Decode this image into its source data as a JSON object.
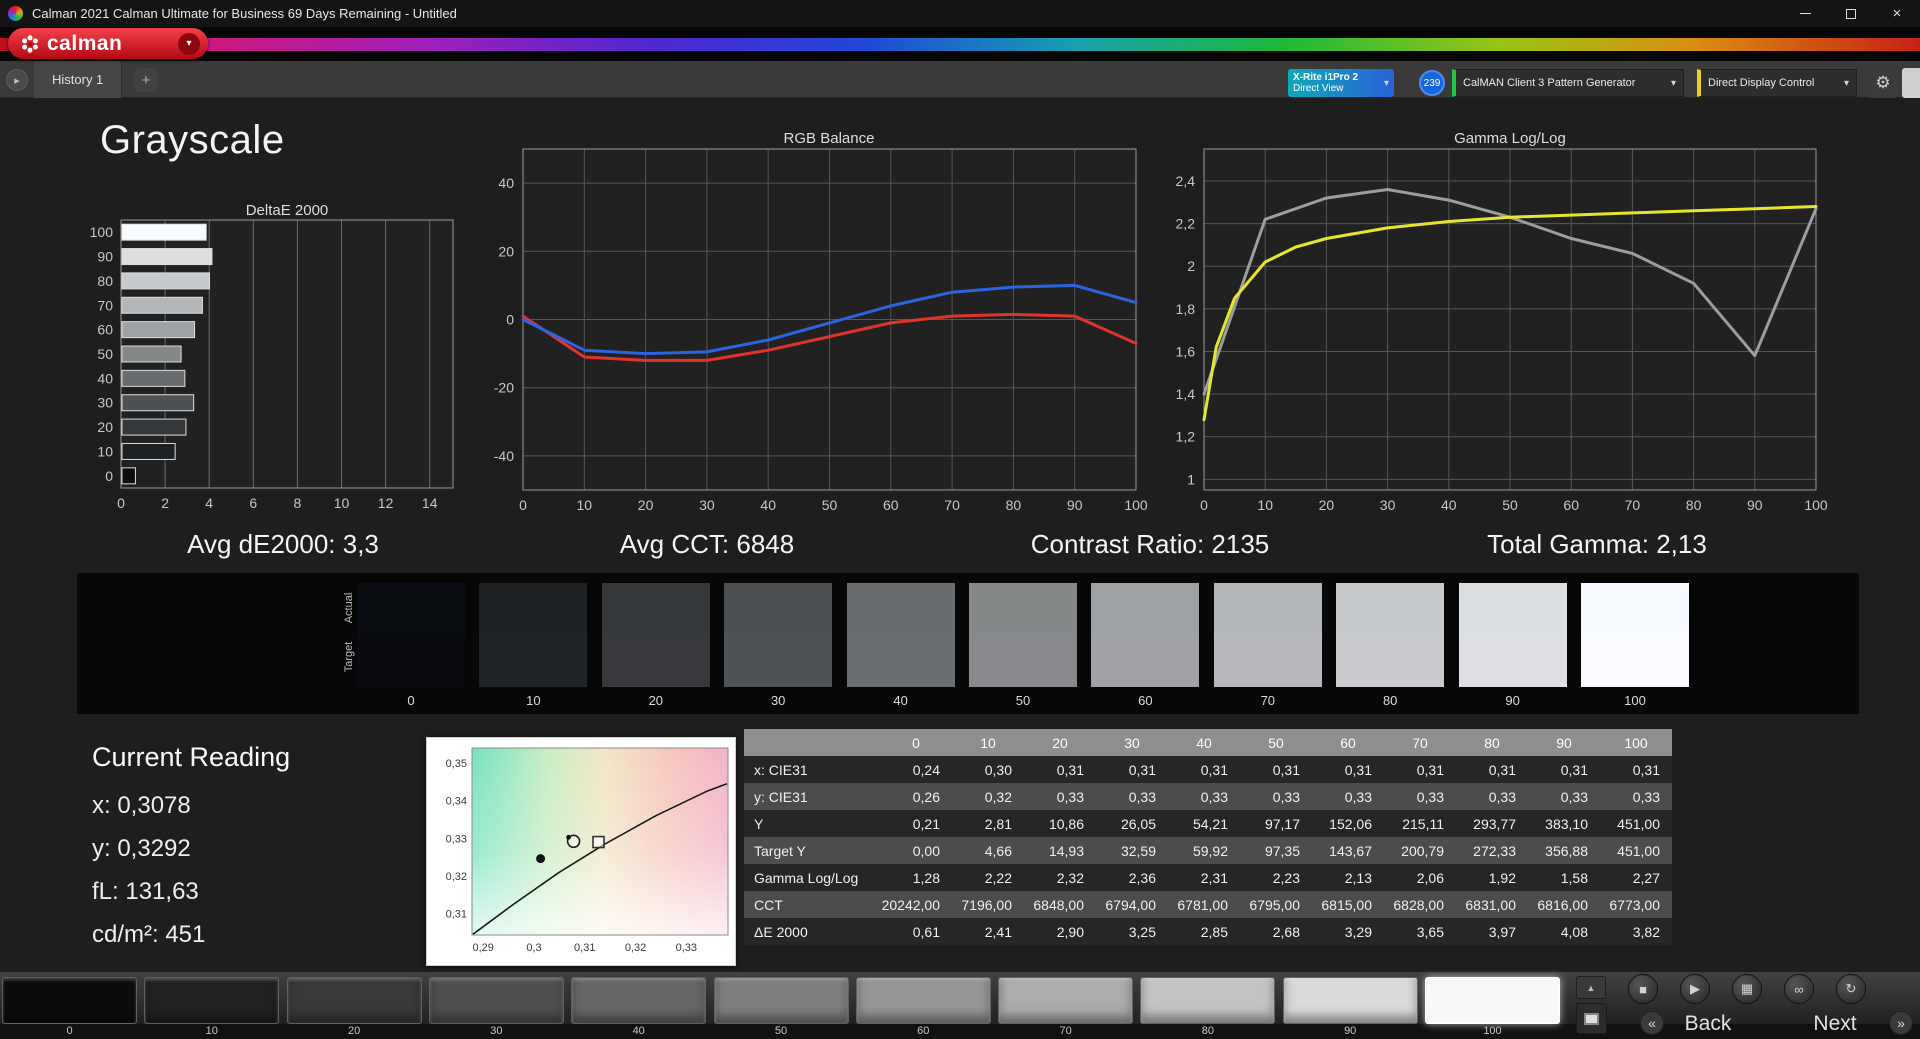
{
  "window": {
    "title": "Calman 2021 Calman Ultimate for Business 69 Days Remaining  - Untitled",
    "close_glyph": "×"
  },
  "brand": {
    "logo_text": "calman"
  },
  "ui": {
    "dropdown_glyph": "▾",
    "history_nav_glyph": "▸",
    "gear_glyph": "⚙",
    "collapse_glyph": "▲",
    "prev_symbol": "«",
    "next_symbol": "»"
  },
  "tab_bar": {
    "history_tab": "History 1",
    "add_tab": "+"
  },
  "toolbar": {
    "meter_line1": "X-Rite i1Pro 2",
    "meter_line2": "Direct View",
    "badge": "239",
    "pattern_generator": "CalMAN Client 3 Pattern Generator",
    "display_control": "Direct Display Control"
  },
  "page": {
    "title": "Grayscale"
  },
  "stats": {
    "avg_de": "Avg dE2000: 3,3",
    "avg_cct": "Avg CCT: 6848",
    "contrast": "Contrast Ratio: 2135",
    "total_gamma": "Total Gamma: 2,13"
  },
  "swatch_panel": {
    "actual_label": "Actual",
    "target_label": "Target",
    "labels": [
      "0",
      "10",
      "20",
      "30",
      "40",
      "50",
      "60",
      "70",
      "80",
      "90",
      "100"
    ],
    "actual_colors": [
      "#0b0e12",
      "#1e2124",
      "#35383b",
      "#4e5154",
      "#696c6f",
      "#858888",
      "#9fa2a5",
      "#b3b6b9",
      "#c7cacd",
      "#dcdfe2",
      "#f7faff"
    ],
    "target_colors": [
      "#090b0e",
      "#212427",
      "#37393c",
      "#505356",
      "#6b6e71",
      "#87898c",
      "#a1a3a6",
      "#b5b7ba",
      "#c9cbce",
      "#dee0e3",
      "#fafcff"
    ]
  },
  "current_reading": {
    "title": "Current Reading",
    "x": "x: 0,3078",
    "y": "y: 0,3292",
    "fl": "fL: 131,63",
    "cd": "cd/m²: 451"
  },
  "table": {
    "columns": [
      "",
      "0",
      "10",
      "20",
      "30",
      "40",
      "50",
      "60",
      "70",
      "80",
      "90",
      "100"
    ],
    "rows": [
      {
        "label": "x: CIE31",
        "values": [
          "0,24",
          "0,30",
          "0,31",
          "0,31",
          "0,31",
          "0,31",
          "0,31",
          "0,31",
          "0,31",
          "0,31",
          "0,31"
        ]
      },
      {
        "label": "y: CIE31",
        "values": [
          "0,26",
          "0,32",
          "0,33",
          "0,33",
          "0,33",
          "0,33",
          "0,33",
          "0,33",
          "0,33",
          "0,33",
          "0,33"
        ]
      },
      {
        "label": "Y",
        "values": [
          "0,21",
          "2,81",
          "10,86",
          "26,05",
          "54,21",
          "97,17",
          "152,06",
          "215,11",
          "293,77",
          "383,10",
          "451,00"
        ]
      },
      {
        "label": "Target Y",
        "values": [
          "0,00",
          "4,66",
          "14,93",
          "32,59",
          "59,92",
          "97,35",
          "143,67",
          "200,79",
          "272,33",
          "356,88",
          "451,00"
        ]
      },
      {
        "label": "Gamma Log/Log",
        "values": [
          "1,28",
          "2,22",
          "2,32",
          "2,36",
          "2,31",
          "2,23",
          "2,13",
          "2,06",
          "1,92",
          "1,58",
          "2,27"
        ]
      },
      {
        "label": "CCT",
        "values": [
          "20242,00",
          "7196,00",
          "6848,00",
          "6794,00",
          "6781,00",
          "6795,00",
          "6815,00",
          "6828,00",
          "6831,00",
          "6816,00",
          "6773,00"
        ]
      },
      {
        "label": "ΔE 2000",
        "values": [
          "0,61",
          "2,41",
          "2,90",
          "3,25",
          "2,85",
          "2,68",
          "3,29",
          "3,65",
          "3,97",
          "4,08",
          "3,82"
        ]
      }
    ]
  },
  "bottom_bar": {
    "patch_labels": [
      "0",
      "10",
      "20",
      "30",
      "40",
      "50",
      "60",
      "70",
      "80",
      "90",
      "100"
    ],
    "patch_colors": [
      "#0c0c0c",
      "#222222",
      "#393939",
      "#505050",
      "#676767",
      "#7e7e7e",
      "#959595",
      "#acacac",
      "#c3c3c3",
      "#dadada",
      "#f8f8f8"
    ],
    "selected_patch": "100",
    "transport_icons": [
      "stop",
      "play",
      "save",
      "loop",
      "refresh"
    ],
    "transport_glyphs": {
      "stop": "■",
      "play": "▶",
      "save": "▦",
      "loop": "∞",
      "refresh": "↻"
    },
    "back_label": "Back",
    "next_label": "Next"
  },
  "chart_data": [
    {
      "type": "bar",
      "title": "DeltaE 2000",
      "orientation": "horizontal",
      "categories": [
        100,
        90,
        80,
        70,
        60,
        50,
        40,
        30,
        20,
        10,
        0
      ],
      "values": [
        3.82,
        4.08,
        3.97,
        3.65,
        3.29,
        2.68,
        2.85,
        3.25,
        2.9,
        2.41,
        0.61
      ],
      "xlim": [
        0,
        15
      ],
      "xticks": [
        0,
        2,
        4,
        6,
        8,
        10,
        12,
        14
      ]
    },
    {
      "type": "line",
      "title": "RGB Balance",
      "x": [
        0,
        10,
        20,
        30,
        40,
        50,
        60,
        70,
        80,
        90,
        100
      ],
      "series": [
        {
          "name": "red-balance-line",
          "color": "#df332b",
          "values": [
            1,
            -11,
            -12,
            -12,
            -9,
            -5,
            -1,
            1,
            1.5,
            1,
            -7
          ]
        },
        {
          "name": "blue-balance-line",
          "color": "#2b63e0",
          "values": [
            0,
            -9,
            -10,
            -9.5,
            -6,
            -1,
            4,
            8,
            9.5,
            10,
            5
          ]
        }
      ],
      "ylim": [
        -50,
        50
      ],
      "yticks": [
        40,
        20,
        0,
        -20,
        -40
      ],
      "xticks": [
        0,
        10,
        20,
        30,
        40,
        50,
        60,
        70,
        80,
        90,
        100
      ]
    },
    {
      "type": "line",
      "title": "Gamma Log/Log",
      "series": [
        {
          "name": "per-point-gamma-line",
          "color": "#9d9d9d",
          "x": [
            0,
            10,
            20,
            30,
            40,
            50,
            60,
            70,
            80,
            90,
            100
          ],
          "values": [
            1.4,
            2.22,
            2.32,
            2.36,
            2.31,
            2.23,
            2.13,
            2.06,
            1.92,
            1.58,
            2.27
          ]
        },
        {
          "name": "gamma-curve-line",
          "color": "#e6e62e",
          "x": [
            0,
            2,
            5,
            10,
            15,
            20,
            30,
            40,
            50,
            60,
            70,
            80,
            90,
            100
          ],
          "values": [
            1.28,
            1.62,
            1.85,
            2.02,
            2.09,
            2.13,
            2.18,
            2.21,
            2.23,
            2.24,
            2.25,
            2.26,
            2.27,
            2.28
          ]
        }
      ],
      "ylim": [
        0.95,
        2.55
      ],
      "yticks": [
        2.4,
        2.2,
        2.0,
        1.8,
        1.6,
        1.4,
        1.2,
        1.0
      ],
      "ytick_labels": [
        "2,4",
        "2,2",
        "2",
        "1,8",
        "1,6",
        "1,4",
        "1,2",
        "1"
      ],
      "xticks": [
        0,
        10,
        20,
        30,
        40,
        50,
        60,
        70,
        80,
        90,
        100
      ]
    },
    {
      "type": "scatter",
      "title": "CIE 1931 xy",
      "xlim": [
        0.2878,
        0.3382
      ],
      "ylim": [
        0.3043,
        0.354
      ],
      "xticks": [
        0.29,
        0.3,
        0.31,
        0.32,
        0.33
      ],
      "xtick_labels": [
        "0,29",
        "0,3",
        "0,31",
        "0,32",
        "0,33"
      ],
      "yticks": [
        0.35,
        0.34,
        0.33,
        0.32,
        0.31
      ],
      "ytick_labels": [
        "0,35",
        "0,34",
        "0,33",
        "0,32",
        "0,31"
      ],
      "points": [
        {
          "name": "measured-point",
          "x": 0.3013,
          "y": 0.3246,
          "marker": "filled-circle"
        },
        {
          "name": "current-reading-point",
          "x": 0.3078,
          "y": 0.3292,
          "marker": "circle"
        },
        {
          "name": "target-point",
          "x": 0.3127,
          "y": 0.329,
          "marker": "square"
        }
      ],
      "locus": [
        [
          0.288,
          0.3045
        ],
        [
          0.296,
          0.3125
        ],
        [
          0.305,
          0.321
        ],
        [
          0.314,
          0.3285
        ],
        [
          0.324,
          0.336
        ],
        [
          0.334,
          0.3425
        ],
        [
          0.338,
          0.3445
        ]
      ]
    }
  ]
}
